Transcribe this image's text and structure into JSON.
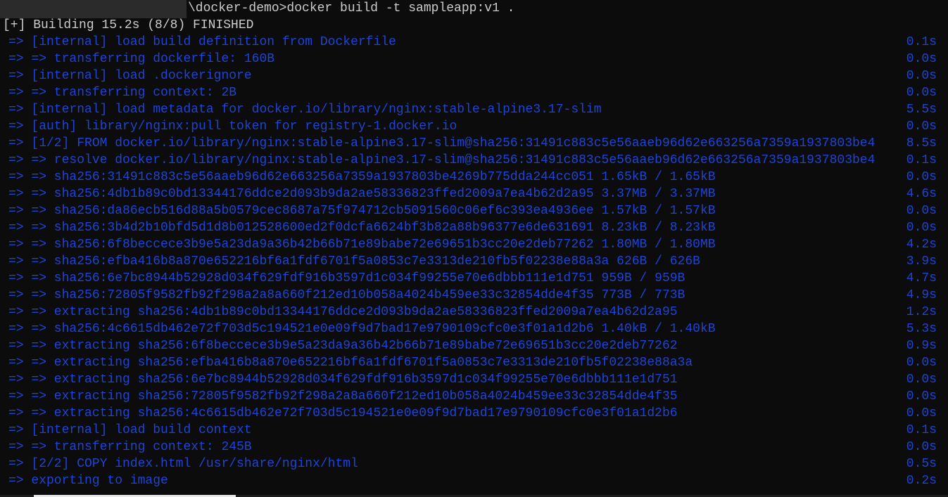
{
  "terminal": {
    "command": "\\docker-demo>docker build -t sampleapp:v1 .",
    "status": "[+] Building 15.2s (8/8) FINISHED",
    "colors": {
      "background": "#0c0c0c",
      "text": "#cccccc",
      "progress": "#1f44d6"
    },
    "lines": [
      {
        "text": "=> [internal] load build definition from Dockerfile",
        "time": "0.1s"
      },
      {
        "text": "=> => transferring dockerfile: 160B",
        "time": "0.0s"
      },
      {
        "text": "=> [internal] load .dockerignore",
        "time": "0.0s"
      },
      {
        "text": "=> => transferring context: 2B",
        "time": "0.0s"
      },
      {
        "text": "=> [internal] load metadata for docker.io/library/nginx:stable-alpine3.17-slim",
        "time": "5.5s"
      },
      {
        "text": "=> [auth] library/nginx:pull token for registry-1.docker.io",
        "time": "0.0s"
      },
      {
        "text": "=> [1/2] FROM docker.io/library/nginx:stable-alpine3.17-slim@sha256:31491c883c5e56aaeb96d62e663256a7359a1937803be4",
        "time": "8.5s"
      },
      {
        "text": "=> => resolve docker.io/library/nginx:stable-alpine3.17-slim@sha256:31491c883c5e56aaeb96d62e663256a7359a1937803be4",
        "time": "0.1s"
      },
      {
        "text": "=> => sha256:31491c883c5e56aaeb96d62e663256a7359a1937803be4269b775dda244cc051 1.65kB / 1.65kB",
        "time": "0.0s"
      },
      {
        "text": "=> => sha256:4db1b89c0bd13344176ddce2d093b9da2ae58336823ffed2009a7ea4b62d2a95 3.37MB / 3.37MB",
        "time": "4.6s"
      },
      {
        "text": "=> => sha256:da86ecb516d88a5b0579cec8687a75f974712cb5091560c06ef6c393ea4936ee 1.57kB / 1.57kB",
        "time": "0.0s"
      },
      {
        "text": "=> => sha256:3b4d2b10bfd5d1d8b012528600ed2f0dcfa6624bf3b82a88b96377e6de631691 8.23kB / 8.23kB",
        "time": "0.0s"
      },
      {
        "text": "=> => sha256:6f8beccece3b9e5a23da9a36b42b66b71e89babe72e69651b3cc20e2deb77262 1.80MB / 1.80MB",
        "time": "4.2s"
      },
      {
        "text": "=> => sha256:efba416b8a870e652216bf6a1fdf6701f5a0853c7e3313de210fb5f02238e88a3a 626B / 626B",
        "time": "3.9s"
      },
      {
        "text": "=> => sha256:6e7bc8944b52928d034f629fdf916b3597d1c034f99255e70e6dbbb111e1d751 959B / 959B",
        "time": "4.7s"
      },
      {
        "text": "=> => sha256:72805f9582fb92f298a2a8a660f212ed10b058a4024b459ee33c32854dde4f35 773B / 773B",
        "time": "4.9s"
      },
      {
        "text": "=> => extracting sha256:4db1b89c0bd13344176ddce2d093b9da2ae58336823ffed2009a7ea4b62d2a95",
        "time": "1.2s"
      },
      {
        "text": "=> => sha256:4c6615db462e72f703d5c194521e0e09f9d7bad17e9790109cfc0e3f01a1d2b6 1.40kB / 1.40kB",
        "time": "5.3s"
      },
      {
        "text": "=> => extracting sha256:6f8beccece3b9e5a23da9a36b42b66b71e89babe72e69651b3cc20e2deb77262",
        "time": "0.9s"
      },
      {
        "text": "=> => extracting sha256:efba416b8a870e652216bf6a1fdf6701f5a0853c7e3313de210fb5f02238e88a3a",
        "time": "0.0s"
      },
      {
        "text": "=> => extracting sha256:6e7bc8944b52928d034f629fdf916b3597d1c034f99255e70e6dbbb111e1d751",
        "time": "0.0s"
      },
      {
        "text": "=> => extracting sha256:72805f9582fb92f298a2a8a660f212ed10b058a4024b459ee33c32854dde4f35",
        "time": "0.0s"
      },
      {
        "text": "=> => extracting sha256:4c6615db462e72f703d5c194521e0e09f9d7bad17e9790109cfc0e3f01a1d2b6",
        "time": "0.0s"
      },
      {
        "text": "=> [internal] load build context",
        "time": "0.1s"
      },
      {
        "text": "=> => transferring context: 245B",
        "time": "0.0s"
      },
      {
        "text": "=> [2/2] COPY index.html /usr/share/nginx/html",
        "time": "0.5s"
      },
      {
        "text": "=> exporting to image",
        "time": "0.2s"
      }
    ]
  }
}
